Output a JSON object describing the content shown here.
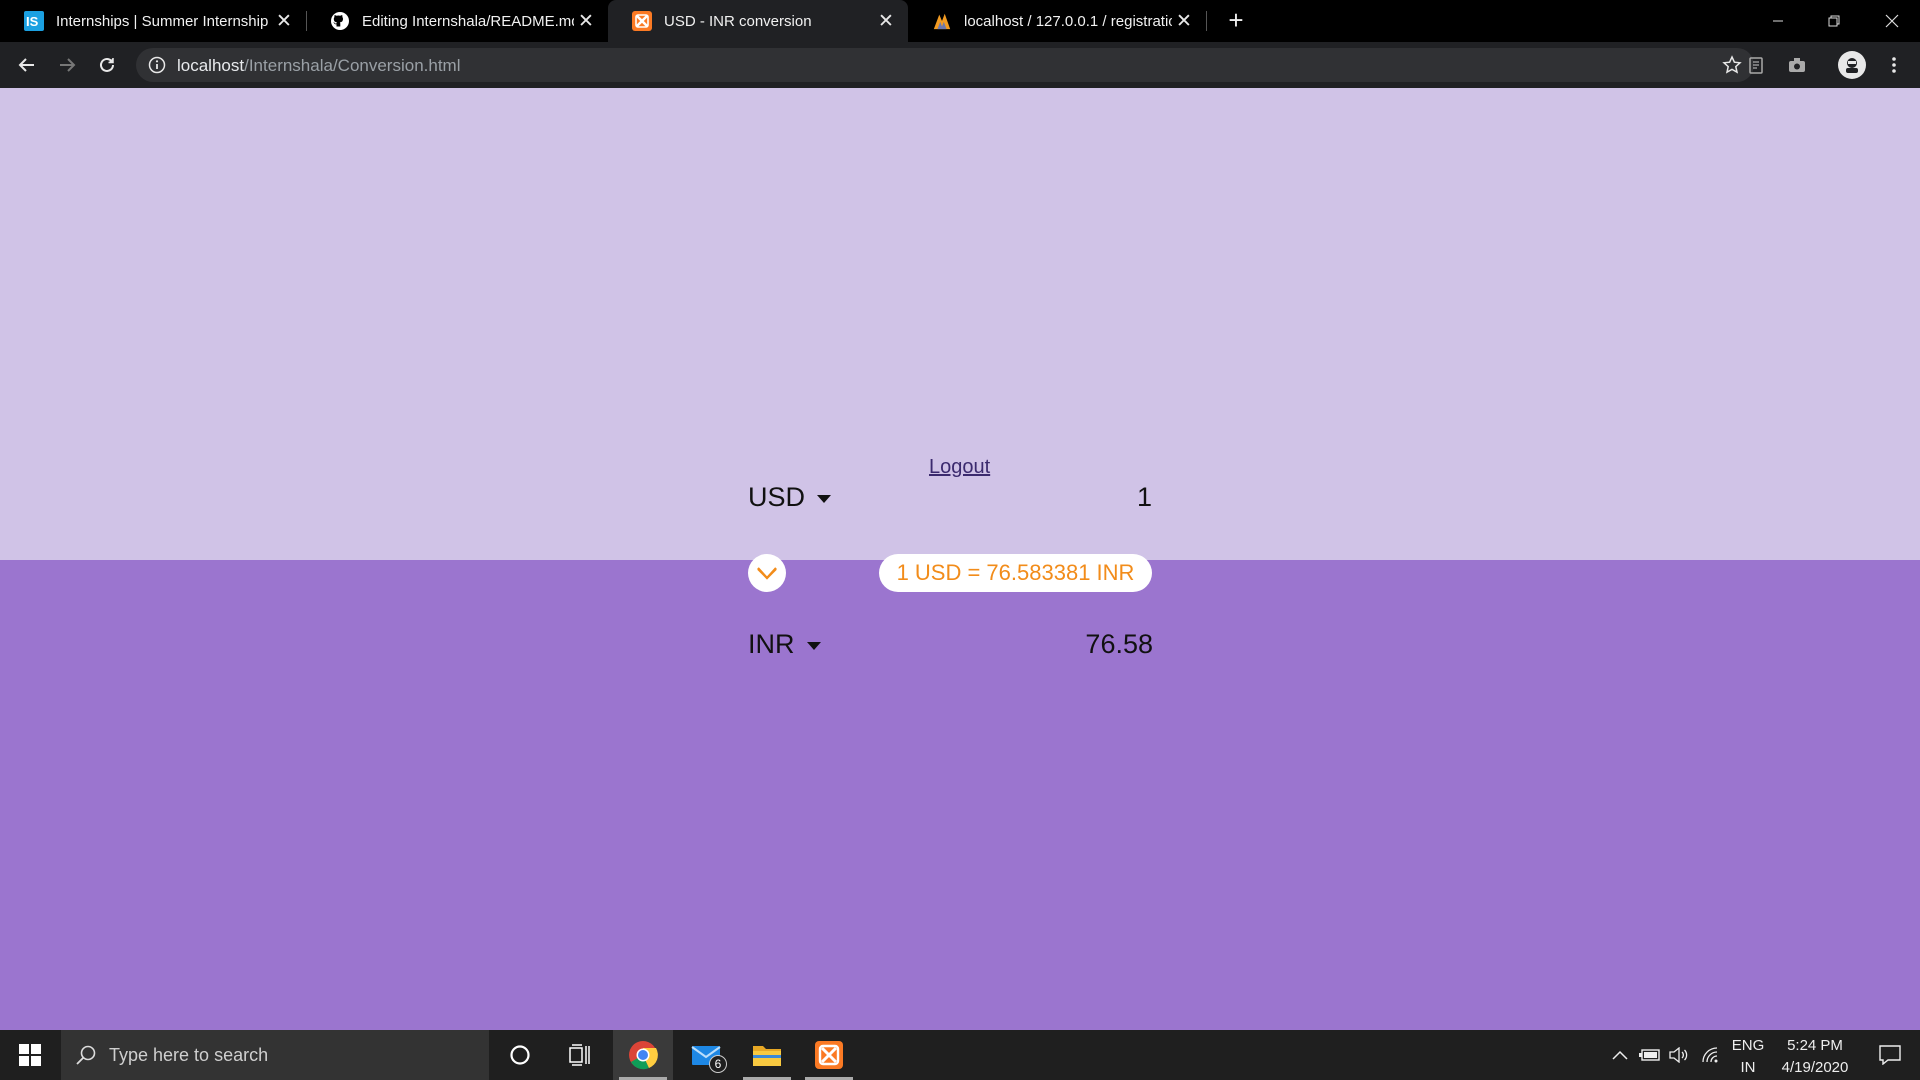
{
  "browser": {
    "tabs": [
      {
        "title": "Internships | Summer Internship",
        "icon": "internshala-icon",
        "active": false
      },
      {
        "title": "Editing Internshala/README.md",
        "icon": "github-icon",
        "active": false
      },
      {
        "title": "USD - INR conversion",
        "icon": "xampp-icon",
        "active": true
      },
      {
        "title": "localhost / 127.0.0.1 / registration",
        "icon": "phpmyadmin-icon",
        "active": false
      }
    ],
    "new_tab_label": "+",
    "address": {
      "host": "localhost",
      "path": "/Internshala/Conversion.html"
    }
  },
  "page": {
    "logout_label": "Logout",
    "from": {
      "currency": "USD",
      "amount": "1"
    },
    "to": {
      "currency": "INR",
      "amount": "76.58"
    },
    "rate_text": "1 USD = 76.583381 INR",
    "colors": {
      "upper_bg": "#d0c3e7",
      "lower_bg": "#9b75cf",
      "accent": "#f28c1a"
    }
  },
  "taskbar": {
    "search_placeholder": "Type here to search",
    "mail_badge": "6",
    "lang_line1": "ENG",
    "lang_line2": "IN",
    "time": "5:24 PM",
    "date": "4/19/2020"
  }
}
